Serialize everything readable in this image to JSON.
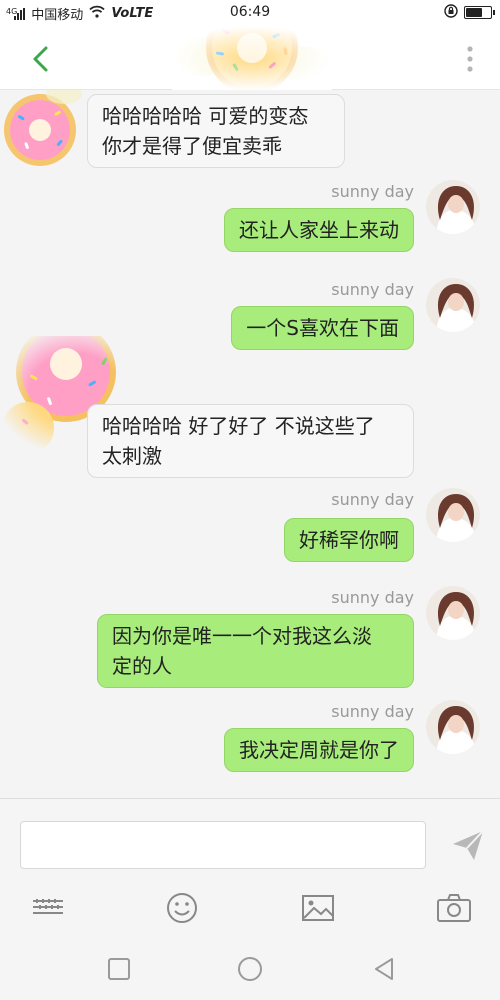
{
  "status_bar": {
    "network_type": "4G",
    "carrier": "中国移动",
    "volte": "VoLTE",
    "time": "06:49",
    "battery_level": 0.7
  },
  "header": {
    "back_icon": "chevron-left-icon",
    "more_icon": "more-vertical-icon",
    "accent_color": "#3aa84a"
  },
  "messages": [
    {
      "direction": "in",
      "text": "哈哈哈哈哈 可爱的变态\n你才是得了便宜卖乖"
    },
    {
      "direction": "out",
      "sender": "sunny day",
      "text": "还让人家坐上来动"
    },
    {
      "direction": "out",
      "sender": "sunny day",
      "text": "一个S喜欢在下面"
    },
    {
      "direction": "in",
      "text": "哈哈哈哈 好了好了 不说这些了\n太刺激"
    },
    {
      "direction": "out",
      "sender": "sunny day",
      "text": "好稀罕你啊"
    },
    {
      "direction": "out",
      "sender": "sunny day",
      "text": "因为你是唯一一个对我这么淡\n定的人"
    },
    {
      "direction": "out",
      "sender": "sunny day",
      "text": "我决定周就是你了"
    }
  ],
  "composer": {
    "input_value": "",
    "send_icon": "send-icon",
    "tools": [
      "keyboard-icon",
      "emoji-icon",
      "image-icon",
      "camera-icon"
    ]
  },
  "nav_bar": {
    "buttons": [
      "recent-apps-icon",
      "home-icon",
      "back-triangle-icon"
    ]
  },
  "colors": {
    "outgoing_bubble": "#a8ec7b",
    "incoming_bubble": "#f7f7f7",
    "chat_background": "#f4f4f4"
  }
}
